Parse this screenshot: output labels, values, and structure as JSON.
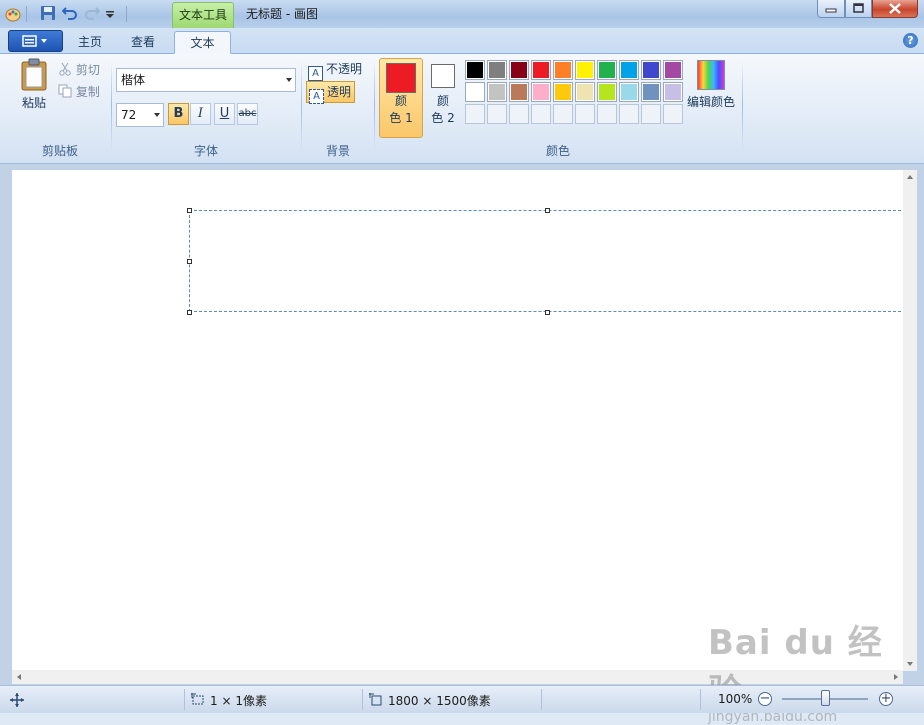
{
  "window": {
    "title": "无标题 - 画图",
    "context_tab": "文本工具"
  },
  "tabs": [
    {
      "label": "主页"
    },
    {
      "label": "查看"
    },
    {
      "label": "文本",
      "active": true
    }
  ],
  "clipboard": {
    "paste": "粘贴",
    "cut": "剪切",
    "copy": "复制",
    "group": "剪贴板"
  },
  "font": {
    "family": "楷体",
    "size": "72",
    "bold": "B",
    "italic": "I",
    "underline": "U",
    "strike": "abc",
    "group": "字体"
  },
  "background": {
    "opaque": "不透明",
    "transparent": "透明",
    "group": "背景",
    "selected": "透明"
  },
  "colors": {
    "color1_label_a": "颜",
    "color1_label_b": "色 1",
    "color2_label_a": "颜",
    "color2_label_b": "色 2",
    "color1": "#ed1c24",
    "color2": "#ffffff",
    "edit": "编辑颜色",
    "group": "颜色",
    "palette_row1": [
      "#000000",
      "#7f7f7f",
      "#880015",
      "#ed1c24",
      "#ff7f27",
      "#fff200",
      "#22b14c",
      "#00a2e8",
      "#3f48cc",
      "#a349a4"
    ],
    "palette_row2": [
      "#ffffff",
      "#c3c3c3",
      "#b97a57",
      "#ffaec9",
      "#ffc90e",
      "#efe4b0",
      "#b5e61d",
      "#99d9ea",
      "#7092be",
      "#c8bfe7"
    ]
  },
  "status": {
    "selection_size": "1 × 1像素",
    "canvas_size": "1800 × 1500像素",
    "zoom": "100%"
  },
  "watermark": {
    "brand": "Bai du 经验",
    "url": "jingyan.baidu.com"
  }
}
